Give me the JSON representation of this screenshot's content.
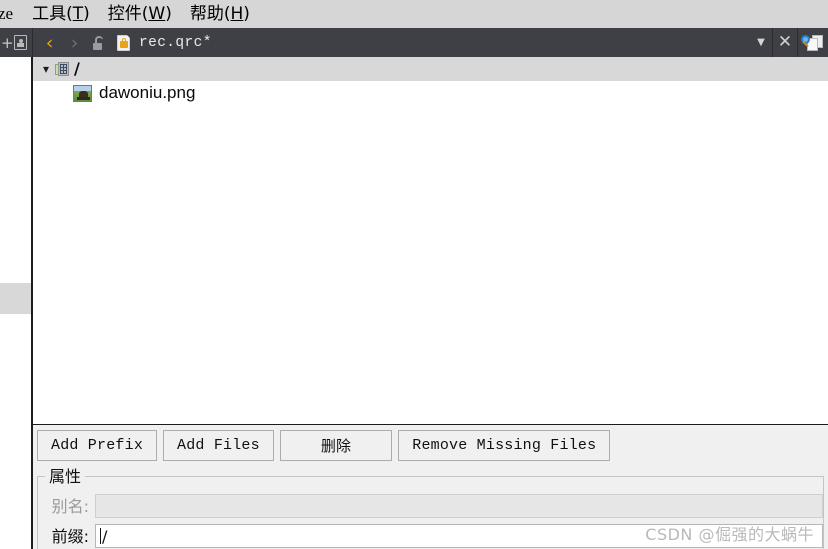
{
  "menubar": {
    "items": [
      {
        "label": "ze",
        "mnemonic": "",
        "clipped": true
      },
      {
        "label": "工具(T)",
        "pre": "工具(",
        "mnemonic": "T",
        "post": ")"
      },
      {
        "label": "控件(W)",
        "pre": "控件(",
        "mnemonic": "W",
        "post": ")"
      },
      {
        "label": "帮助(H)",
        "pre": "帮助(",
        "mnemonic": "H",
        "post": ")"
      }
    ]
  },
  "toolbar": {
    "add_label": "+",
    "split_icon": "split-view-icon",
    "back_glyph": "‹",
    "forward_glyph": "›",
    "lock_icon": "unlocked-padlock-icon",
    "file_icon": "locked-file-icon",
    "filename": "rec.qrc*",
    "caret_glyph": "▼",
    "close_glyph": "✕",
    "compare_icon": "find-in-files-icon",
    "bg_color": "#3f3f46"
  },
  "tree": {
    "rows": [
      {
        "label": "/",
        "icon": "resource-root-icon",
        "expanded": true,
        "chevron": "❯",
        "selected": true,
        "depth": 0
      },
      {
        "label": "dawoniu.png",
        "icon": "image-thumbnail-icon",
        "selected": false,
        "depth": 1
      }
    ],
    "selection_color": "#d8d8d8"
  },
  "buttons": [
    {
      "label": "Add Prefix",
      "name": "add-prefix-button",
      "cjk": false
    },
    {
      "label": "Add Files",
      "name": "add-files-button",
      "cjk": false
    },
    {
      "label": "删除",
      "name": "remove-button",
      "cjk": true
    },
    {
      "label": "Remove Missing Files",
      "name": "remove-missing-files-button",
      "cjk": false
    }
  ],
  "properties": {
    "group_title": "属性",
    "fields": [
      {
        "label": "别名:",
        "name": "alias-field",
        "value": "",
        "placeholder": "",
        "enabled": false
      },
      {
        "label": "前缀:",
        "name": "prefix-field",
        "value": "/",
        "placeholder": "",
        "enabled": true
      }
    ]
  },
  "watermark": {
    "text": "CSDN @倔强的大蜗牛"
  }
}
